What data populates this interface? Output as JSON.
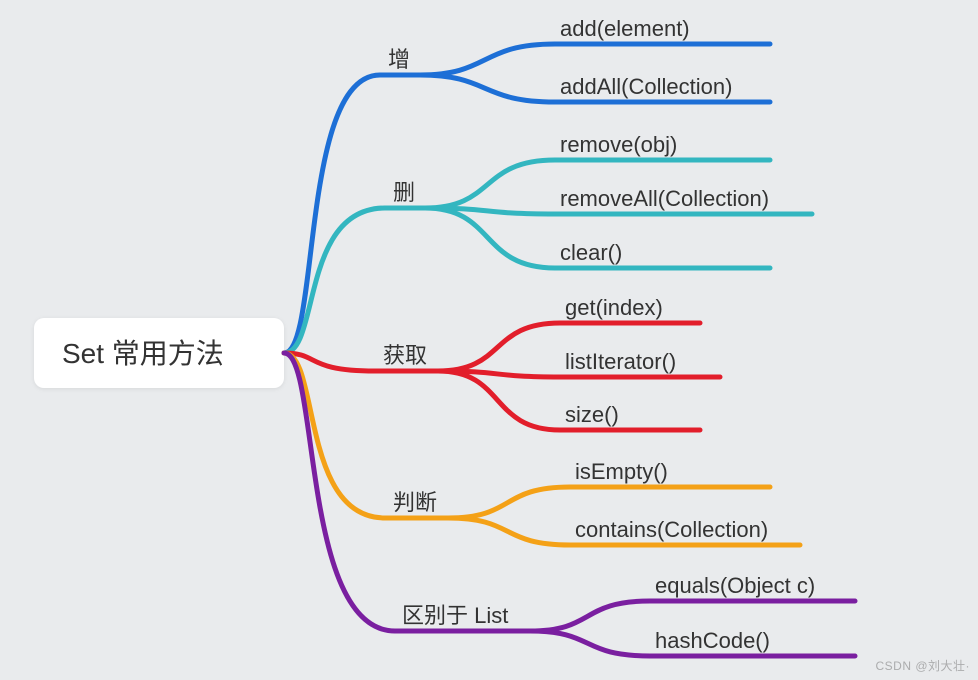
{
  "root": {
    "label": "Set 常用方法"
  },
  "branches": [
    {
      "label": "增",
      "color": "#1d6fd6",
      "leaves": [
        "add(element)",
        "addAll(Collection)"
      ]
    },
    {
      "label": "删",
      "color": "#33b6c0",
      "leaves": [
        "remove(obj)",
        "removeAll(Collection)",
        "clear()"
      ]
    },
    {
      "label": "获取",
      "color": "#e21e2b",
      "leaves": [
        "get(index)",
        "listIterator()",
        "size()"
      ]
    },
    {
      "label": "判断",
      "color": "#f4a117",
      "leaves": [
        "isEmpty()",
        "contains(Collection)"
      ]
    },
    {
      "label": "区别于 List",
      "color": "#7a1fa0",
      "leaves": [
        "equals(Object c)",
        "hashCode()"
      ]
    }
  ],
  "watermark": "CSDN @刘大壮·"
}
